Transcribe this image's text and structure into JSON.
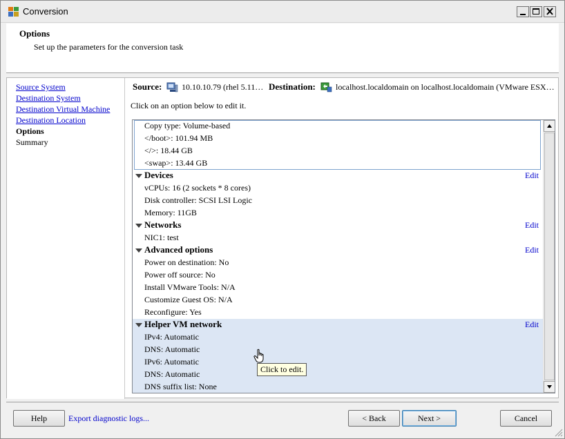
{
  "window": {
    "title": "Conversion",
    "icon": "vmware-converter-icon"
  },
  "header": {
    "title": "Options",
    "subtitle": "Set up the parameters for the conversion task"
  },
  "nav": {
    "items": [
      {
        "label": "Source System",
        "state": "link"
      },
      {
        "label": "Destination System",
        "state": "link"
      },
      {
        "label": "Destination Virtual Machine",
        "state": "link"
      },
      {
        "label": "Destination Location",
        "state": "link"
      },
      {
        "label": "Options",
        "state": "current"
      },
      {
        "label": "Summary",
        "state": "plain"
      }
    ]
  },
  "summary_bar": {
    "source_label": "Source:",
    "source_value": "10.10.10.79 (rhel 5.11…",
    "destination_label": "Destination:",
    "destination_value": "localhost.localdomain on localhost.localdomain (VMware ESX…"
  },
  "hint": "Click on an option below to edit it.",
  "options": {
    "data_copy": [
      "Copy type: Volume-based",
      "</boot>: 101.94 MB",
      "</>: 18.44 GB",
      "<swap>: 13.44 GB"
    ],
    "devices": {
      "title": "Devices",
      "edit": "Edit",
      "items": [
        "vCPUs: 16 (2 sockets * 8 cores)",
        "Disk controller: SCSI LSI Logic",
        "Memory: 11GB"
      ]
    },
    "networks": {
      "title": "Networks",
      "edit": "Edit",
      "items": [
        "NIC1: test"
      ]
    },
    "advanced": {
      "title": "Advanced options",
      "edit": "Edit",
      "items": [
        "Power on destination: No",
        "Power off source: No",
        "Install VMware Tools: N/A",
        "Customize Guest OS: N/A",
        "Reconfigure: Yes"
      ]
    },
    "helper": {
      "title": "Helper VM network",
      "edit": "Edit",
      "items": [
        "IPv4: Automatic",
        "DNS: Automatic",
        "IPv6: Automatic",
        "DNS: Automatic",
        "DNS suffix list: None"
      ]
    }
  },
  "tooltip": "Click to edit.",
  "footer": {
    "help": "Help",
    "export": "Export diagnostic logs...",
    "back": "< Back",
    "next": "Next >",
    "cancel": "Cancel"
  },
  "colors": {
    "link": "#0000cc",
    "highlight": "#dce6f4",
    "tooltip_bg": "#ffffe1"
  }
}
